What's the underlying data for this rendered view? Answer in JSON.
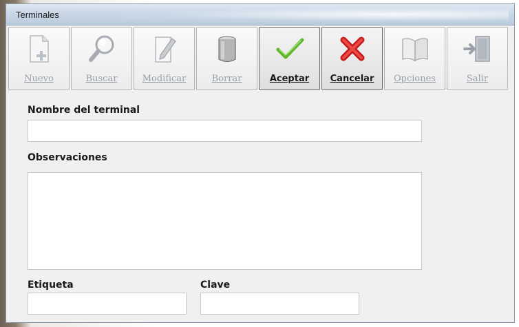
{
  "window": {
    "title": "Terminales"
  },
  "toolbar": {
    "buttons": [
      {
        "label": "Nuevo",
        "icon": "new-document-icon",
        "state": "disabled"
      },
      {
        "label": "Buscar",
        "icon": "magnifier-icon",
        "state": "disabled"
      },
      {
        "label": "Modificar",
        "icon": "edit-pencil-icon",
        "state": "disabled"
      },
      {
        "label": "Borrar",
        "icon": "trash-bin-icon",
        "state": "disabled"
      },
      {
        "label": "Aceptar",
        "icon": "checkmark-icon",
        "state": "enabled"
      },
      {
        "label": "Cancelar",
        "icon": "cross-icon",
        "state": "enabled"
      },
      {
        "label": "Opciones",
        "icon": "book-icon",
        "state": "disabled"
      },
      {
        "label": "Salir",
        "icon": "exit-door-icon",
        "state": "disabled"
      }
    ]
  },
  "form": {
    "nombre": {
      "label": "Nombre del terminal",
      "value": ""
    },
    "observaciones": {
      "label": "Observaciones",
      "value": ""
    },
    "etiqueta": {
      "label": "Etiqueta",
      "value": ""
    },
    "clave": {
      "label": "Clave",
      "value": ""
    }
  },
  "colors": {
    "accept_green": "#5cb82a",
    "cancel_red": "#d62121",
    "disabled_text": "#9aa0a8"
  }
}
